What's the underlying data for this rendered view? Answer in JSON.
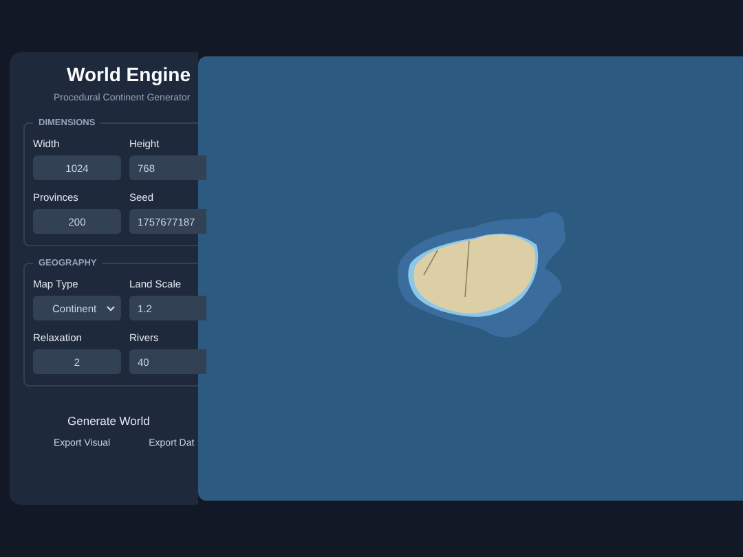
{
  "panel": {
    "title": "World Engine",
    "subtitle": "Procedural Continent Generator"
  },
  "sections": [
    {
      "legend": "DIMENSIONS",
      "fields": [
        {
          "kind": "input",
          "label": "Width",
          "value": "1024"
        },
        {
          "kind": "input",
          "label": "Height",
          "value": "768"
        },
        {
          "kind": "input",
          "label": "Provinces",
          "value": "200"
        },
        {
          "kind": "input",
          "label": "Seed",
          "value": "1757677187"
        }
      ]
    },
    {
      "legend": "GEOGRAPHY",
      "fields": [
        {
          "kind": "select",
          "label": "Map Type",
          "value": "Continent"
        },
        {
          "kind": "input",
          "label": "Land Scale",
          "value": "1.2"
        },
        {
          "kind": "input",
          "label": "Relaxation",
          "value": "2"
        },
        {
          "kind": "input",
          "label": "Rivers",
          "value": "40"
        }
      ]
    }
  ],
  "generate_button": "Generate World",
  "export_buttons": [
    "Export Visual",
    "Export Dat"
  ]
}
